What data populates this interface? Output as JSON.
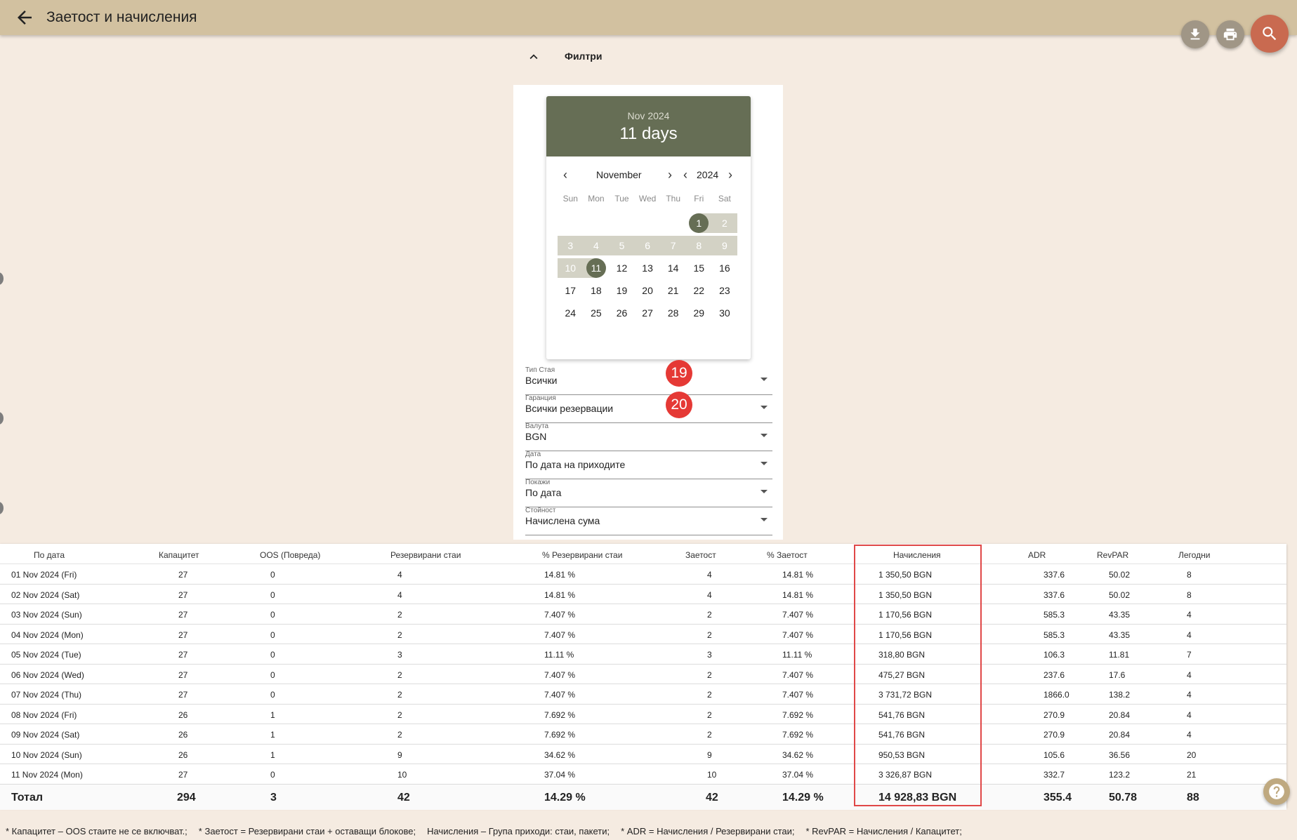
{
  "header": {
    "title": "Заетост и начисления"
  },
  "actions": {
    "download": "download-icon",
    "print": "print-icon",
    "search": "search-icon"
  },
  "filters": {
    "title": "Филтри",
    "datepicker": {
      "header_month_year": "Nov 2024",
      "header_summary": "11 days",
      "month": "November",
      "year": "2024",
      "weekdays": [
        "Sun",
        "Mon",
        "Tue",
        "Wed",
        "Thu",
        "Fri",
        "Sat"
      ],
      "weeks": [
        [
          "",
          "",
          "",
          "",
          "",
          "1",
          "2"
        ],
        [
          "3",
          "4",
          "5",
          "6",
          "7",
          "8",
          "9"
        ],
        [
          "10",
          "11",
          "12",
          "13",
          "14",
          "15",
          "16"
        ],
        [
          "17",
          "18",
          "19",
          "20",
          "21",
          "22",
          "23"
        ],
        [
          "24",
          "25",
          "26",
          "27",
          "28",
          "29",
          "30"
        ]
      ],
      "range_start": "1",
      "range_end": "11"
    },
    "fields": [
      {
        "label": "Тип Стая",
        "value": "Всички"
      },
      {
        "label": "Гаранция",
        "value": "Всички резервации"
      },
      {
        "label": "Валута",
        "value": "BGN"
      },
      {
        "label": "Дата",
        "value": "По дата на приходите"
      },
      {
        "label": "Покажи",
        "value": "По дата"
      },
      {
        "label": "Стойност",
        "value": "Начислена сума"
      }
    ],
    "badges": [
      "19",
      "20"
    ]
  },
  "table": {
    "headers": [
      "По дата",
      "Капацитет",
      "OOS (Повреда)",
      "Резервирани стаи",
      "% Резервирани стаи",
      "Заетост",
      "% Заетост",
      "Начисления",
      "ADR",
      "RevPAR",
      "Легодни"
    ],
    "rows": [
      [
        "01 Nov 2024 (Fri)",
        "27",
        "0",
        "4",
        "14.81 %",
        "4",
        "14.81 %",
        "1 350,50 BGN",
        "337.6",
        "50.02",
        "8"
      ],
      [
        "02 Nov 2024 (Sat)",
        "27",
        "0",
        "4",
        "14.81 %",
        "4",
        "14.81 %",
        "1 350,50 BGN",
        "337.6",
        "50.02",
        "8"
      ],
      [
        "03 Nov 2024 (Sun)",
        "27",
        "0",
        "2",
        "7.407 %",
        "2",
        "7.407 %",
        "1 170,56 BGN",
        "585.3",
        "43.35",
        "4"
      ],
      [
        "04 Nov 2024 (Mon)",
        "27",
        "0",
        "2",
        "7.407 %",
        "2",
        "7.407 %",
        "1 170,56 BGN",
        "585.3",
        "43.35",
        "4"
      ],
      [
        "05 Nov 2024 (Tue)",
        "27",
        "0",
        "3",
        "11.11 %",
        "3",
        "11.11 %",
        "318,80 BGN",
        "106.3",
        "11.81",
        "7"
      ],
      [
        "06 Nov 2024 (Wed)",
        "27",
        "0",
        "2",
        "7.407 %",
        "2",
        "7.407 %",
        "475,27 BGN",
        "237.6",
        "17.6",
        "4"
      ],
      [
        "07 Nov 2024 (Thu)",
        "27",
        "0",
        "2",
        "7.407 %",
        "2",
        "7.407 %",
        "3 731,72 BGN",
        "1866.0",
        "138.2",
        "4"
      ],
      [
        "08 Nov 2024 (Fri)",
        "26",
        "1",
        "2",
        "7.692 %",
        "2",
        "7.692 %",
        "541,76 BGN",
        "270.9",
        "20.84",
        "4"
      ],
      [
        "09 Nov 2024 (Sat)",
        "26",
        "1",
        "2",
        "7.692 %",
        "2",
        "7.692 %",
        "541,76 BGN",
        "270.9",
        "20.84",
        "4"
      ],
      [
        "10 Nov 2024 (Sun)",
        "26",
        "1",
        "9",
        "34.62 %",
        "9",
        "34.62 %",
        "950,53 BGN",
        "105.6",
        "36.56",
        "20"
      ],
      [
        "11 Nov 2024 (Mon)",
        "27",
        "0",
        "10",
        "37.04 %",
        "10",
        "37.04 %",
        "3 326,87 BGN",
        "332.7",
        "123.2",
        "21"
      ]
    ],
    "total": [
      "Тотал",
      "294",
      "3",
      "42",
      "14.29 %",
      "42",
      "14.29 %",
      "14 928,83 BGN",
      "355.4",
      "50.78",
      "88"
    ]
  },
  "footnotes": [
    "* Капацитет – OOS стаите не се включват.;",
    "* Заетост = Резервирани стаи + оставащи блокове;",
    "Начисления – Група приходи: стаи, пакети;",
    "* ADR = Начисления / Резервирани стаи;",
    "* RevPAR = Начисления / Капацитет;"
  ],
  "help": {
    "icon": "help-icon"
  }
}
